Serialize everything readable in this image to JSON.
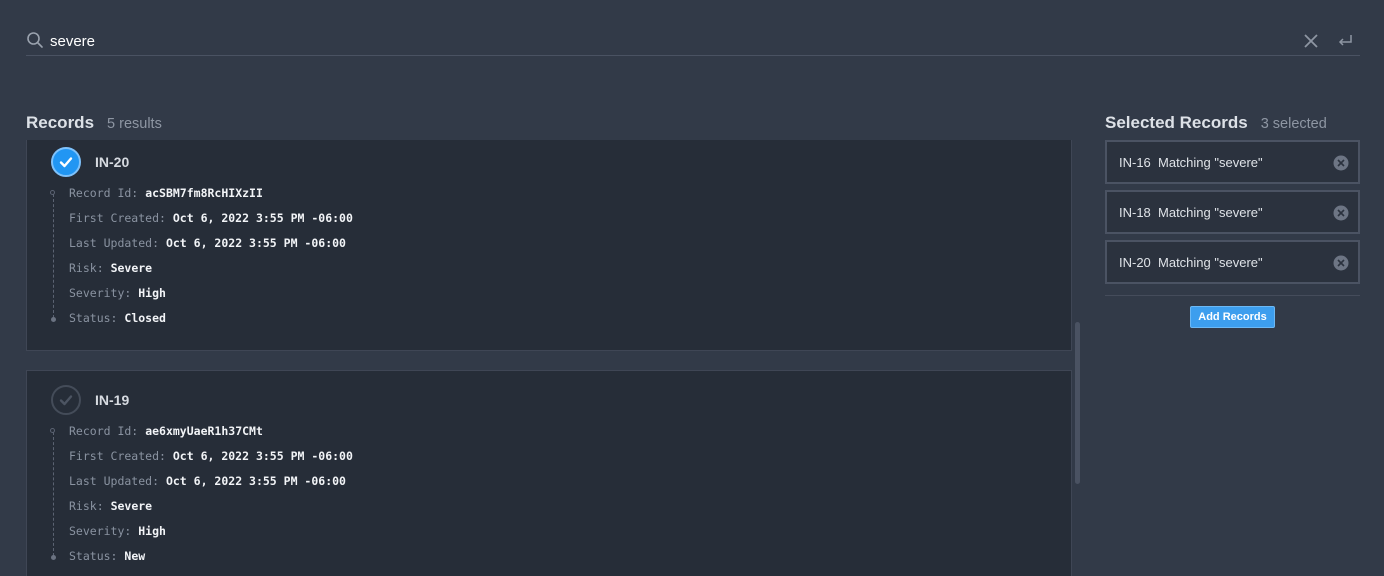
{
  "search": {
    "value": "severe",
    "icon": "search-icon",
    "clear_icon": "close-icon",
    "submit_icon": "enter-icon"
  },
  "records_panel": {
    "title": "Records",
    "count": "5 results"
  },
  "records": [
    {
      "id": "IN-20",
      "selected": true,
      "fields": [
        {
          "label": "Record Id:",
          "value": "acSBM7fm8RcHIXzII"
        },
        {
          "label": "First Created:",
          "value": "Oct 6, 2022 3:55 PM -06:00"
        },
        {
          "label": "Last Updated:",
          "value": "Oct 6, 2022 3:55 PM -06:00"
        },
        {
          "label": "Risk:",
          "value": "Severe"
        },
        {
          "label": "Severity:",
          "value": "High"
        },
        {
          "label": "Status:",
          "value": "Closed"
        }
      ]
    },
    {
      "id": "IN-19",
      "selected": false,
      "fields": [
        {
          "label": "Record Id:",
          "value": "ae6xmyUaeR1h37CMt"
        },
        {
          "label": "First Created:",
          "value": "Oct 6, 2022 3:55 PM -06:00"
        },
        {
          "label": "Last Updated:",
          "value": "Oct 6, 2022 3:55 PM -06:00"
        },
        {
          "label": "Risk:",
          "value": "Severe"
        },
        {
          "label": "Severity:",
          "value": "High"
        },
        {
          "label": "Status:",
          "value": "New"
        }
      ]
    }
  ],
  "selected_panel": {
    "title": "Selected Records",
    "count": "3 selected",
    "items": [
      {
        "text": "IN-16  Matching \"severe\""
      },
      {
        "text": "IN-18  Matching \"severe\""
      },
      {
        "text": "IN-20  Matching \"severe\""
      }
    ],
    "add_button": "Add Records"
  },
  "colors": {
    "background": "#323a48",
    "card": "#262d38",
    "accent": "#2196f3"
  }
}
